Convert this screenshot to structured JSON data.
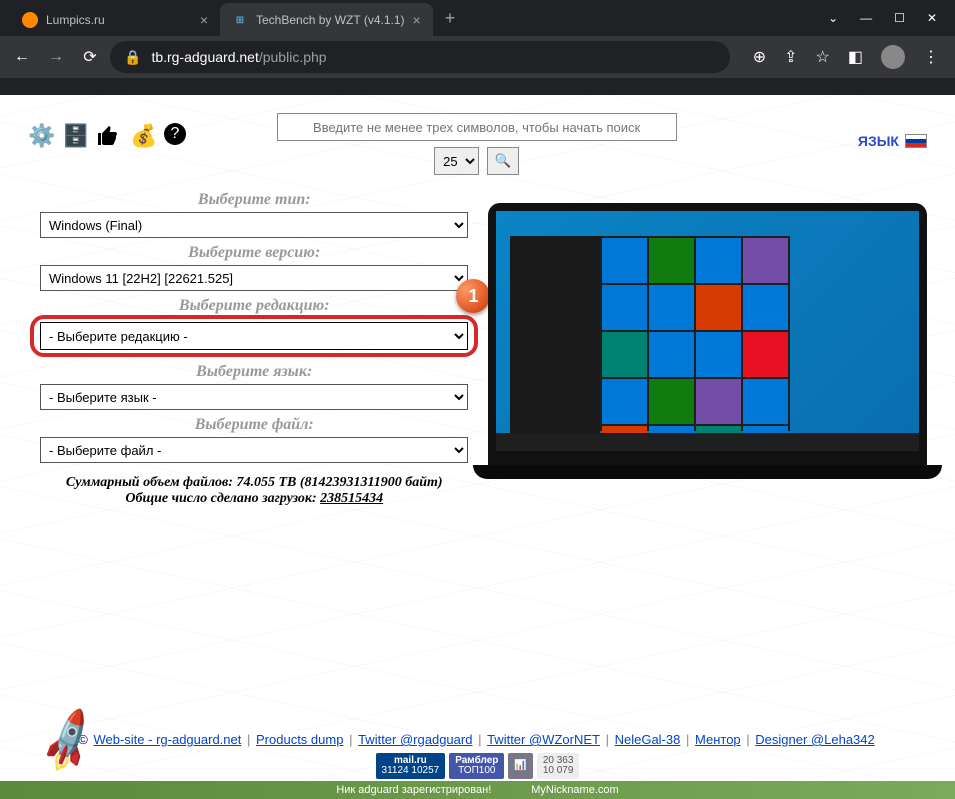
{
  "browser": {
    "tabs": [
      {
        "title": "Lumpics.ru",
        "favicon_color": "#ff8800"
      },
      {
        "title": "TechBench by WZT (v4.1.1)",
        "favicon_text": "⊞"
      }
    ],
    "url_domain": "tb.rg-adguard.net",
    "url_path": "/public.php"
  },
  "search": {
    "placeholder": "Введите не менее трех символов, чтобы начать поиск",
    "per_page": "25"
  },
  "lang": {
    "label": "ЯЗЫК"
  },
  "form": {
    "type_label": "Выберите тип:",
    "type_value": "Windows (Final)",
    "version_label": "Выберите версию:",
    "version_value": "Windows 11 [22H2] [22621.525]",
    "edition_label": "Выберите редакцию:",
    "edition_value": "- Выберите редакцию -",
    "lang_label": "Выберите язык:",
    "lang_value": "- Выберите язык -",
    "file_label": "Выберите файл:",
    "file_value": "- Выберите файл -"
  },
  "badge": {
    "number": "1"
  },
  "stats": {
    "size_line": "Суммарный объем файлов: 74.055 TB (81423931311900 байт)",
    "downloads_prefix": "Общие число сделано загрузок: ",
    "downloads_count": "238515434"
  },
  "footer": {
    "links": [
      "Web-site - rg-adguard.net",
      "Products dump",
      "Twitter @rgadguard",
      "Twitter @WZorNET",
      "NeleGal-38",
      "Ментор",
      "Designer @Leha342"
    ],
    "copyright": "©",
    "mailru_top": "mail.ru",
    "mailru_bottom": "31124  10257",
    "rambler_top": "Рамблер",
    "rambler_bottom": "ТОП100",
    "li_top": "20 363",
    "li_bottom": "10 079",
    "nickname_left": "Ник adguard зарегистрирован!",
    "nickname_right": "MyNickname.com"
  }
}
